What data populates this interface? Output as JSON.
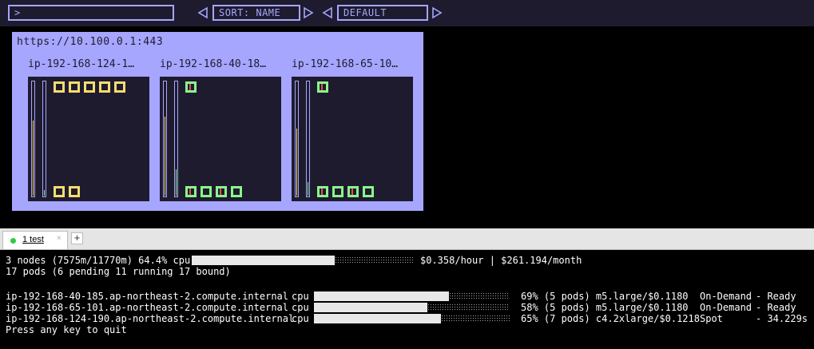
{
  "toolbar": {
    "filter_value": ">",
    "sort_label": "SORT: NAME",
    "profile_label": "DEFAULT"
  },
  "cluster": {
    "url": "https://10.100.0.1:443",
    "nodes": [
      {
        "name": "ip-192-168-124-1…",
        "cpu_level": 0.65,
        "mem_level": 0.05,
        "top_pods": [
          "yellow",
          "yellow",
          "yellow",
          "yellow",
          "yellow"
        ],
        "bottom_pods": [
          "yellow",
          "yellow"
        ]
      },
      {
        "name": "ip-192-168-40-18…",
        "cpu_level": 0.69,
        "mem_level": 0.23,
        "top_pods": [
          "green"
        ],
        "bottom_pods": [
          "green",
          "green",
          "green",
          "green"
        ]
      },
      {
        "name": "ip-192-168-65-10…",
        "cpu_level": 0.58,
        "mem_level": 0.12,
        "top_pods": [
          "green"
        ],
        "bottom_pods": [
          "green",
          "green",
          "green",
          "green"
        ]
      }
    ]
  },
  "terminal": {
    "tab_label": "1 test",
    "tab_close": "×",
    "tab_add": "+",
    "summary": {
      "text_left": "3 nodes (7575m/11770m) 64.4% cpu",
      "fraction": 0.644,
      "text_right": "$0.358/hour | $261.194/month"
    },
    "pods_line": "17 pods (6 pending 11 running 17 bound)",
    "rows": [
      {
        "name": "ip-192-168-40-185.ap-northeast-2.compute.internal",
        "resource": "cpu",
        "fraction": 0.69,
        "stats": "69% (5 pods) m5.large/$0.1180",
        "capacity": "On-Demand",
        "status": "- Ready"
      },
      {
        "name": "ip-192-168-65-101.ap-northeast-2.compute.internal",
        "resource": "cpu",
        "fraction": 0.58,
        "stats": "58% (5 pods) m5.large/$0.1180",
        "capacity": "On-Demand",
        "status": "- Ready"
      },
      {
        "name": "ip-192-168-124-190.ap-northeast-2.compute.internal",
        "resource": "cpu",
        "fraction": 0.65,
        "stats": "65% (7 pods) c4.2xlarge/$0.1218",
        "capacity": "Spot",
        "status": "- 34.229s"
      }
    ],
    "footer": "Press any key to quit"
  }
}
